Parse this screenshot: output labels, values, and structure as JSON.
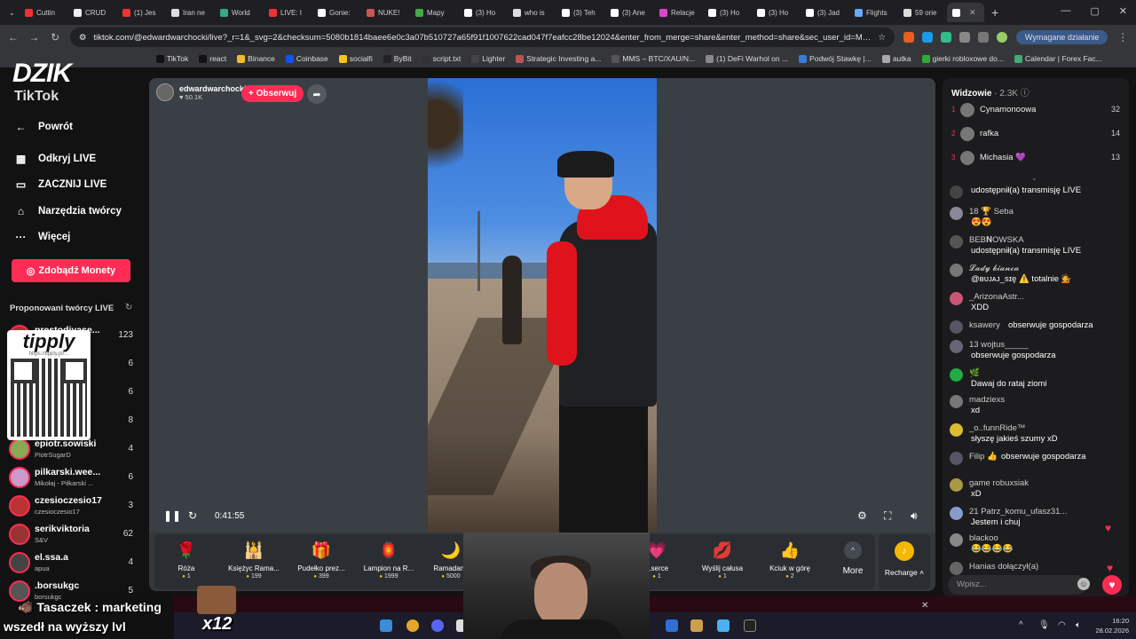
{
  "browser": {
    "tabs": [
      {
        "title": "Cuttin",
        "color": "#e33"
      },
      {
        "title": "CRUD",
        "color": "#eee"
      },
      {
        "title": "(1) Jes",
        "color": "#e33"
      },
      {
        "title": "Iran ne",
        "color": "#ddd"
      },
      {
        "title": "World",
        "color": "#3a8"
      },
      {
        "title": "LIVE: I",
        "color": "#e33"
      },
      {
        "title": "Gonie:",
        "color": "#fff"
      },
      {
        "title": "NUKE!",
        "color": "#c55"
      },
      {
        "title": "Mapy",
        "color": "#4a4"
      },
      {
        "title": "(3) Ho",
        "color": "#fff"
      },
      {
        "title": "who is",
        "color": "#ddd"
      },
      {
        "title": "(3) Teh",
        "color": "#fff"
      },
      {
        "title": "(3) Ane",
        "color": "#fff"
      },
      {
        "title": "Relacje",
        "color": "#d4c"
      },
      {
        "title": "(3) Ho",
        "color": "#fff"
      },
      {
        "title": "(3) Ho",
        "color": "#fff"
      },
      {
        "title": "(3) Jad",
        "color": "#fff"
      },
      {
        "title": "Flights",
        "color": "#6af"
      },
      {
        "title": "59 orie",
        "color": "#ddd"
      },
      {
        "title": "",
        "color": "#fff",
        "active": true
      }
    ],
    "url": "tiktok.com/@edwardwarchocki/live?_r=1&_svg=2&checksum=5080b1814baee6e0c3a07b510727a65f91f1007622cad047f7eafcc28be12024&enter_from_merge=share&enter_method=share&sec_user_id=MS4wLj...",
    "required_action": "Wymagane działanie",
    "bookmarks": [
      "TikTok",
      "react",
      "Binance",
      "Coinbase",
      "socialfi",
      "ByBit",
      "script.txt",
      "Lighter",
      "Strategic Investing a...",
      "MMS – BTC/XAU/N...",
      "(1) DeFi Warhol on ...",
      "Podwój Stawkę |...",
      "autka",
      "gierki robloxowe do...",
      "Calendar | Forex Fac..."
    ]
  },
  "brand": {
    "overlay": "DZIK",
    "logo": "TikTok"
  },
  "nav": {
    "back": "Powrót",
    "items": [
      "Odkryj LIVE",
      "ZACZNIJ LIVE",
      "Narzędzia twórcy",
      "Więcej"
    ],
    "coins": "Zdobądź Monety",
    "suggested_title": "Proponowani twórcy LIVE"
  },
  "creators": [
    {
      "name": "prestodiyase...",
      "sub": "",
      "count": "123"
    },
    {
      "name": "",
      "sub": "",
      "count": "6"
    },
    {
      "name": "",
      "sub": "",
      "count": "6"
    },
    {
      "name": "",
      "sub": "",
      "count": "8"
    },
    {
      "name": "epiotr.sowiski",
      "sub": "PiotrSugarD",
      "count": "4"
    },
    {
      "name": "pilkarski.wee...",
      "sub": "Mikołaj - Piłkarski ...",
      "count": "6"
    },
    {
      "name": "czesioczesio17",
      "sub": "czesioczesio17",
      "count": "3"
    },
    {
      "name": "serikviktoria",
      "sub": "S&V",
      "count": "62"
    },
    {
      "name": "el.ssa.a",
      "sub": "apua",
      "count": "4"
    },
    {
      "name": ".borsukgc",
      "sub": "borsukgc",
      "count": "5"
    }
  ],
  "qr_overlay": {
    "title": "tipply",
    "url": "https://tipply.pl/..."
  },
  "live": {
    "host": "edwardwarchocki",
    "likes": "50.1K",
    "follow": "+ Obserwuj",
    "elapsed": "0:41:55"
  },
  "gifts": [
    {
      "name": "Róża",
      "price": "1",
      "icon": "🌹"
    },
    {
      "name": "Księżyc Rama...",
      "price": "199",
      "icon": "🕌"
    },
    {
      "name": "Pudełko prez...",
      "price": "399",
      "icon": "🎁"
    },
    {
      "name": "Lampion na R...",
      "price": "1999",
      "icon": "🏮"
    },
    {
      "name": "Ramadano",
      "price": "5000",
      "icon": "🌙"
    },
    {
      "name": "...serce",
      "price": "1",
      "icon": "💗"
    },
    {
      "name": "Wyślij całusa",
      "price": "1",
      "icon": "💋"
    },
    {
      "name": "Kciuk w górę",
      "price": "2",
      "icon": "👍"
    }
  ],
  "more_label": "More",
  "recharge_label": "Recharge",
  "chat": {
    "viewers_label": "Widzowie",
    "viewers_count": "· 2.3K",
    "top": [
      {
        "rank": "1",
        "name": "Cynamonoowa",
        "score": "32"
      },
      {
        "rank": "2",
        "name": "rafka",
        "score": "14"
      },
      {
        "rank": "3",
        "name": "Michasia 💜",
        "score": "13"
      }
    ],
    "messages": [
      {
        "user": "",
        "text": "udostępnił(a) transmisję LIVE",
        "inline": ""
      },
      {
        "user": "18 🏆 Seba",
        "text": "😍😍",
        "inline": ""
      },
      {
        "user": "BEB𝐍OWSKA",
        "text": "udostępnił(a) transmisję LIVE",
        "inline": ""
      },
      {
        "user": "𝓛𝓪𝓭𝔂 𝓫𝓲𝓪𝓷𝓬𝓪",
        "text": "@ʙᴜᴊᴀᴊ_sɪę ⚠️ totalnie 💁",
        "inline": ""
      },
      {
        "user": "_ArizonaAstr...",
        "text": "XDD",
        "inline": ""
      },
      {
        "user": "ksawery",
        "text": "",
        "inline": "obserwuje gospodarza"
      },
      {
        "user": "13 wojtus_____",
        "text": "obserwuje gospodarza",
        "inline": ""
      },
      {
        "user": "🌿",
        "text": "Dawaj do rataj ziomi",
        "inline": ""
      },
      {
        "user": "madziexs",
        "text": "xd",
        "inline": ""
      },
      {
        "user": "_o..funnRide™",
        "text": "słyszę jakieś szumy xD",
        "inline": ""
      },
      {
        "user": "Filip 👍",
        "text": "",
        "inline": "obserwuje gospodarza"
      },
      {
        "user": "game robuxsiak",
        "text": "xD",
        "inline": ""
      },
      {
        "user": "21 Patrz_komu_ufasz31...",
        "text": "Jestem i chuj",
        "inline": ""
      },
      {
        "user": "blackoo",
        "text": "😂😂😂😂",
        "inline": ""
      },
      {
        "user": "Hanias dołączył(a)",
        "text": "",
        "inline": ""
      }
    ],
    "input_placeholder": "Wpisz..."
  },
  "overlays": {
    "alert_line1": "Tasaczek : marketing",
    "alert_line2": "wszedł na wyższy lvl",
    "combo": "x12"
  },
  "taskbar": {
    "time": "16:20",
    "date": "28.02.2026"
  }
}
